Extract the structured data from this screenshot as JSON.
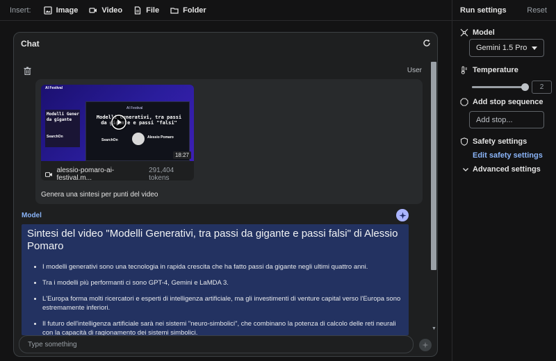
{
  "toolbar": {
    "insert_label": "Insert:",
    "buttons": [
      {
        "label": "Image",
        "icon": "image-icon"
      },
      {
        "label": "Video",
        "icon": "video-icon"
      },
      {
        "label": "File",
        "icon": "file-icon"
      },
      {
        "label": "Folder",
        "icon": "folder-icon"
      }
    ]
  },
  "run_settings": {
    "title": "Run settings",
    "reset_label": "Reset",
    "model_label": "Model",
    "model_value": "Gemini 1.5 Pro",
    "temperature_label": "Temperature",
    "temperature_value": "2",
    "temperature_level": 1.0,
    "stop_sequence_label": "Add stop sequence",
    "stop_placeholder": "Add stop...",
    "safety_label": "Safety settings",
    "edit_safety_label": "Edit safety settings",
    "advanced_label": "Advanced settings"
  },
  "chat": {
    "title": "Chat",
    "user_label": "User",
    "video": {
      "brand": "AI Festival",
      "slide_left_text": "Modelli Gener\nda gigante",
      "slide_title": "Modelli Generativi, tra passi da gigante e passi \"falsi\"",
      "presenter": "Alessio Pomaro",
      "logo_text": "SearchOn",
      "duration": "18:27",
      "filename": "alessio-pomaro-ai-festival.m...",
      "tokens": "291,404 tokens"
    },
    "user_prompt": "Genera una sintesi per punti del video",
    "model_label": "Model",
    "response": {
      "title": "Sintesi del video \"Modelli Generativi, tra passi da gigante e passi falsi\" di Alessio Pomaro",
      "bullets": [
        "I modelli generativi sono una tecnologia in rapida crescita che ha fatto passi da gigante negli ultimi quattro anni.",
        "Tra i modelli più performanti ci sono GPT-4, Gemini e LaMDA 3.",
        "L'Europa forma molti ricercatori e esperti di intelligenza artificiale, ma gli investimenti di venture capital verso l'Europa sono estremamente inferiori.",
        "Il futuro dell'intelligenza artificiale sarà nei sistemi \"neuro-simbolici\", che combinano la potenza di calcolo delle reti neurali con la capacità di ragionamento dei sistemi simbolici."
      ]
    },
    "input_placeholder": "Type something"
  },
  "colors": {
    "accent": "#8ab4f8",
    "response_bg": "#233261",
    "sparkle": "#aab4ff"
  }
}
